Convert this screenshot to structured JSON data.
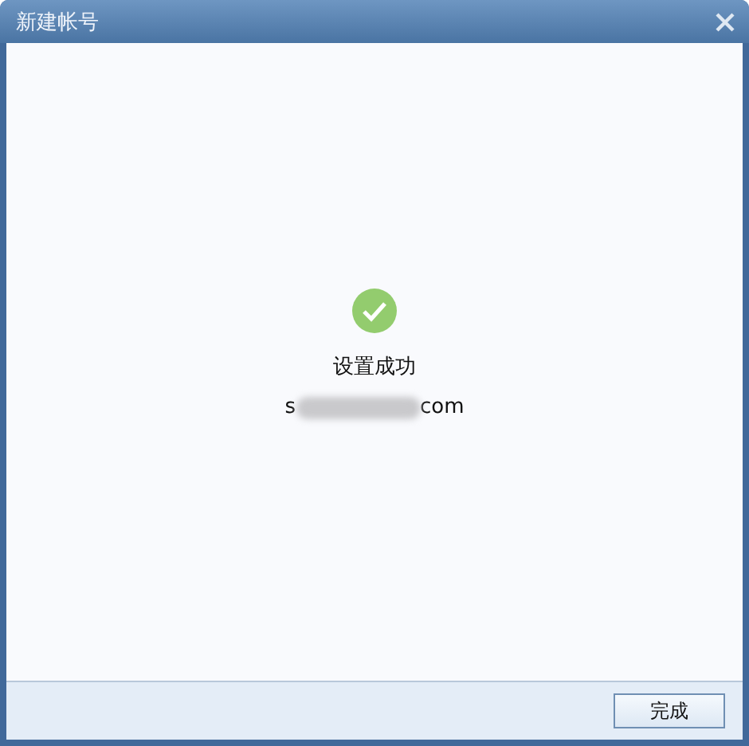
{
  "window": {
    "title": "新建帐号"
  },
  "result": {
    "message": "设置成功",
    "account_start": "s",
    "account_end": "com"
  },
  "buttons": [
    "完成"
  ]
}
